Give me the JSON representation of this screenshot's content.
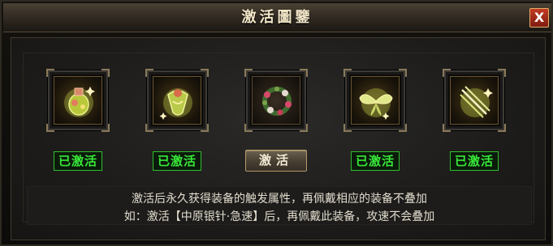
{
  "window": {
    "title": "激活圖鑒",
    "close_label": "X"
  },
  "slots": [
    {
      "icon": "elixir-bottle-icon",
      "status": "已激活",
      "activated": true
    },
    {
      "icon": "amulet-pendant-icon",
      "status": "已激活",
      "activated": true
    },
    {
      "icon": "flower-wreath-icon",
      "button_label": "激活",
      "activated": false
    },
    {
      "icon": "butterfly-ornament-icon",
      "status": "已激活",
      "activated": true
    },
    {
      "icon": "silver-needles-icon",
      "status": "已激活",
      "activated": true
    }
  ],
  "info": {
    "line1": "激活后永久获得装备的触发属性，再佩戴相应的装备不叠加",
    "line2": "如：激活【中原银针·急速】后，再佩戴此装备，攻速不会叠加"
  },
  "colors": {
    "activated_green": "#38e838",
    "title_text": "#f2e6c8",
    "close_red": "#c33a22"
  }
}
